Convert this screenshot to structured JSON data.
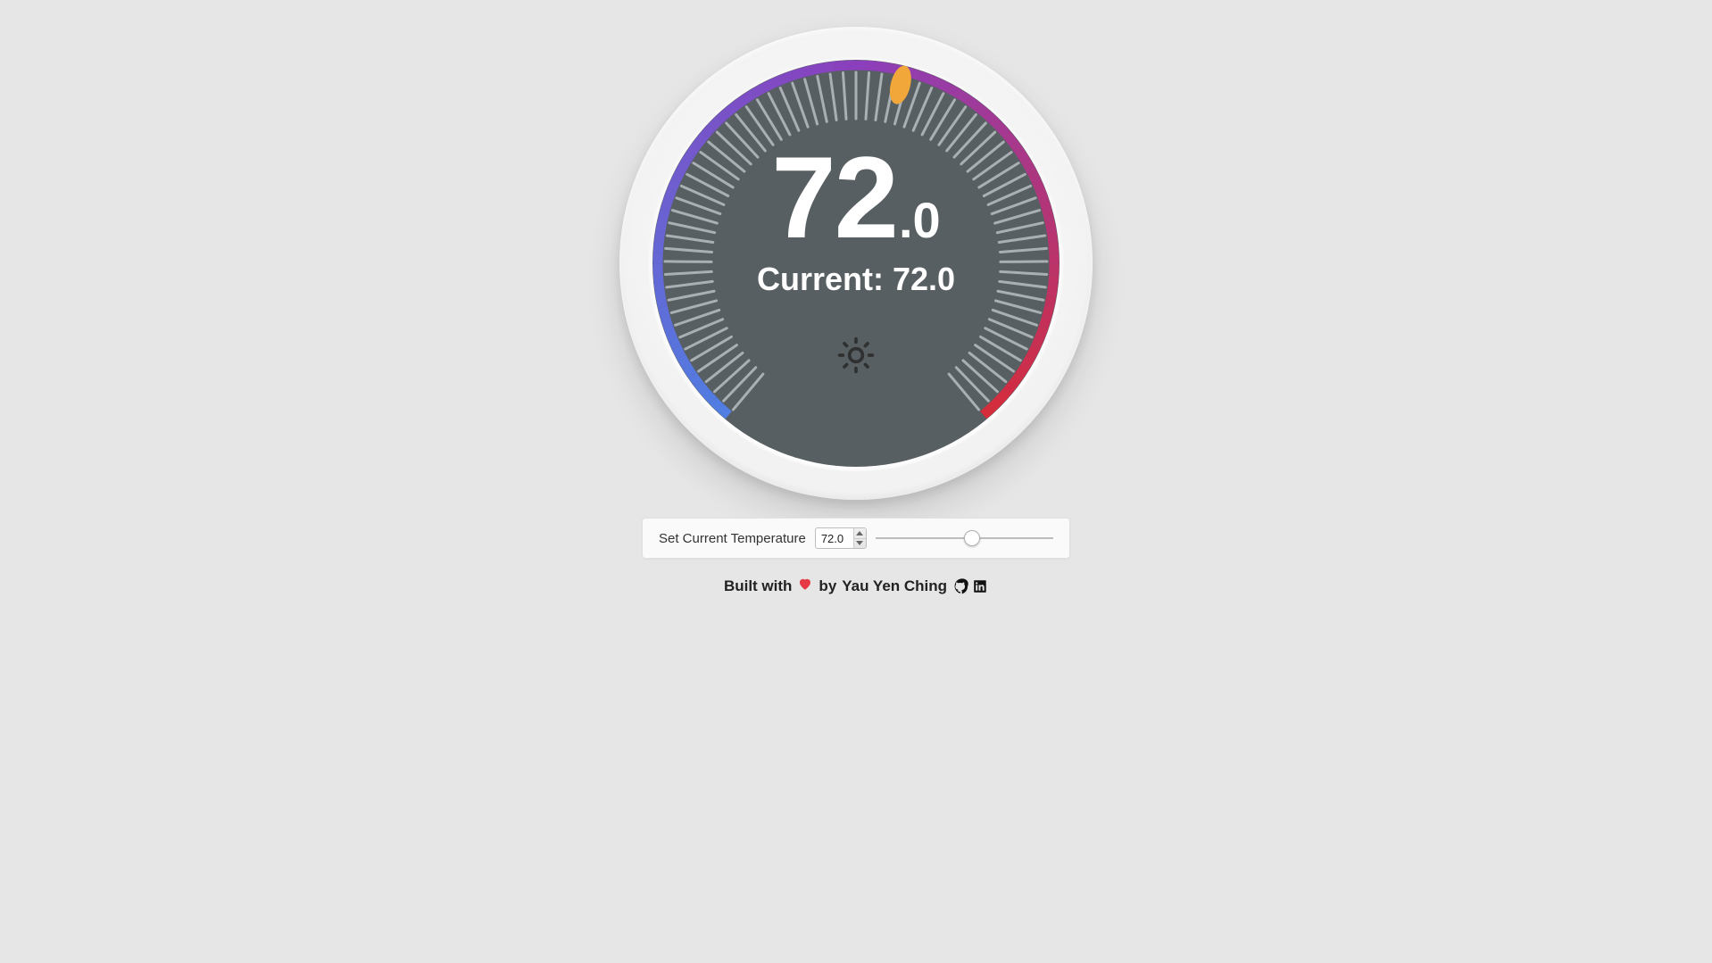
{
  "thermostat": {
    "target_int": "72",
    "target_dec": ".0",
    "current_label_prefix": "Current: ",
    "current_value": "72.0",
    "mode": "sun"
  },
  "controls": {
    "label": "Set Current Temperature",
    "input_value": "72.0",
    "slider_min": "50",
    "slider_max": "90",
    "slider_value": "72"
  },
  "footer": {
    "built_with": "Built with",
    "by": "by",
    "author": "Yau Yen Ching"
  },
  "colors": {
    "dial_face": "#585f63",
    "tick": "#a9afb2",
    "arc_cold": "#4f7fe3",
    "arc_mid": "#8b3fbd",
    "arc_hot": "#d62c3a",
    "indicator": "#f2a73a"
  }
}
